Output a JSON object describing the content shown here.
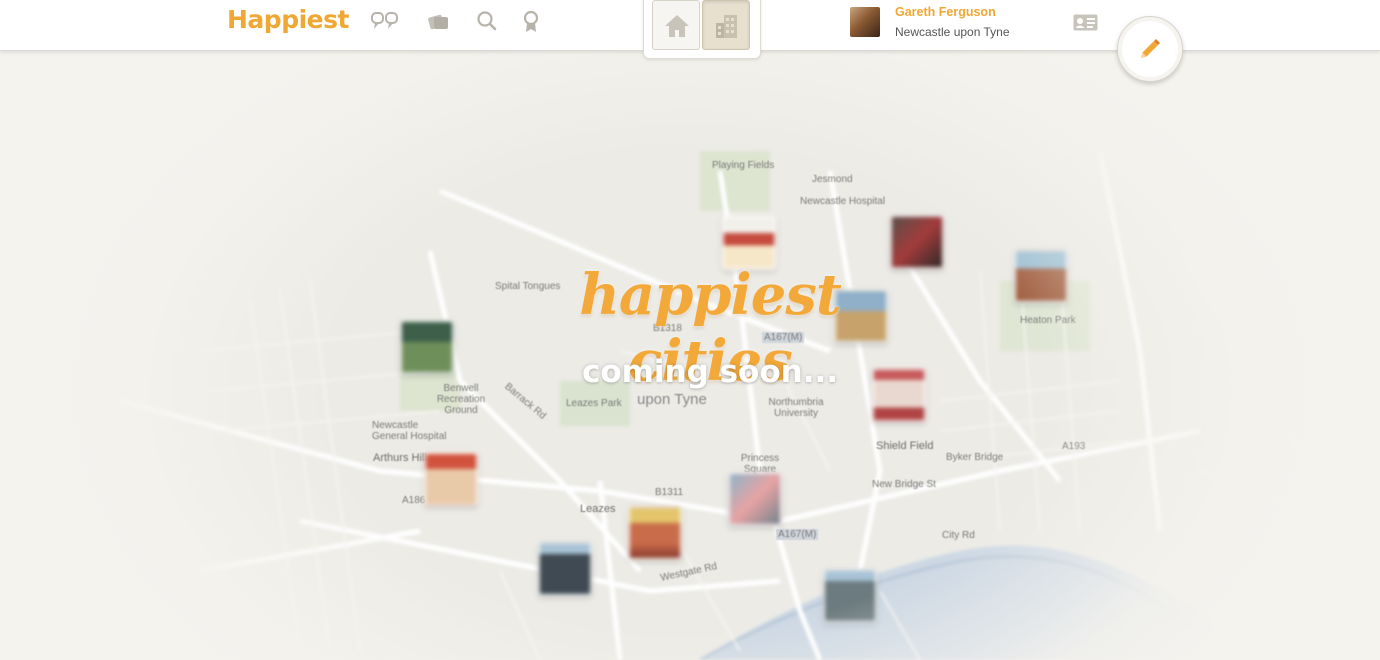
{
  "app": {
    "logo_text": "Happiest",
    "brand_color": "#f0a733"
  },
  "nav": {
    "icons": [
      "quotes-icon",
      "gallery-icon",
      "search-icon",
      "badge-icon"
    ]
  },
  "view_toggle": {
    "options": [
      "home-icon",
      "city-icon"
    ],
    "selected": "city"
  },
  "profile": {
    "name": "Gareth Ferguson",
    "location": "Newcastle upon Tyne"
  },
  "actions": {
    "card_icon": "id-card-icon",
    "edit_icon": "pencil-icon"
  },
  "hero": {
    "title": "happiest cities",
    "subtitle": "coming soon..."
  },
  "map": {
    "labels": {
      "playing_fields": "Playing Fields",
      "jesmond": "Jesmond",
      "newcastle_hospital": "Newcastle Hospital",
      "spital_tongues": "Spital Tongues",
      "heaton_park": "Heaton Park",
      "benwell": "Benwell Recreation Ground",
      "general_hospital": "Newcastle General Hospital",
      "arthurs_hill": "Arthurs Hill",
      "leazes_park": "Leazes Park",
      "upon_tyne": "upon Tyne",
      "northumbria": "Northumbria University",
      "shield_field": "Shield Field",
      "princess_square": "Princess Square",
      "leazes": "Leazes",
      "new_bridge_st": "New Bridge St",
      "byker_bridge": "Byker Bridge",
      "city_rd": "City Rd",
      "barrack_rd": "Barrack Rd",
      "westgate_rd": "Westgate Rd",
      "a186": "A186",
      "a167m": "A167(M)",
      "b1311": "B1311",
      "b1318": "B1318",
      "a193": "A193"
    }
  }
}
